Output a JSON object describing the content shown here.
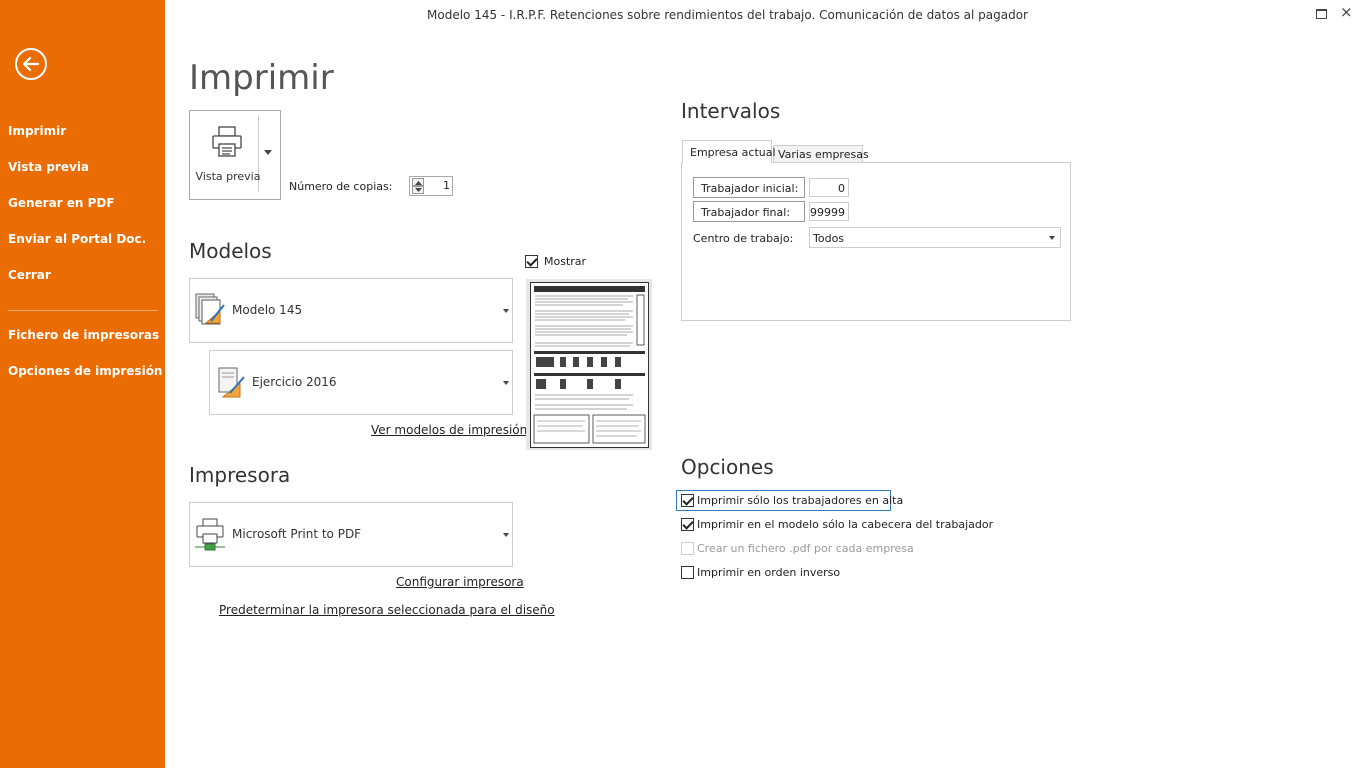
{
  "window": {
    "title": "Modelo 145 - I.R.P.F. Retenciones sobre rendimientos del trabajo. Comunicación de datos al pagador",
    "close_glyph": "×"
  },
  "sidebar": {
    "items": [
      {
        "label": "Imprimir"
      },
      {
        "label": "Vista previa"
      },
      {
        "label": "Generar en PDF"
      },
      {
        "label": "Enviar al Portal Doc."
      },
      {
        "label": "Cerrar"
      },
      {
        "label": "Fichero de impresoras"
      },
      {
        "label": "Opciones de impresión"
      }
    ],
    "color": "#EC6C04"
  },
  "main": {
    "title": "Imprimir",
    "print_button": {
      "label": "Vista previa",
      "icon": "printer-icon"
    },
    "copies": {
      "label": "Número de copias:",
      "value": "1"
    }
  },
  "models": {
    "heading": "Modelos",
    "model_select": {
      "value": "Modelo 145",
      "icon": "model-document-icon"
    },
    "exercise_select": {
      "value": "Ejercicio 2016",
      "icon": "exercise-document-icon"
    },
    "view_models_link": "Ver modelos de impresión",
    "show_label": "Mostrar",
    "show_checked": true
  },
  "printer": {
    "heading": "Impresora",
    "select": {
      "value": "Microsoft Print to PDF",
      "icon": "printer-pdf-icon"
    },
    "configure_link": "Configurar impresora",
    "default_link": "Predeterminar la impresora seleccionada para el diseño"
  },
  "intervals": {
    "heading": "Intervalos",
    "tabs": [
      {
        "label": "Empresa actual",
        "active": true
      },
      {
        "label": "Varias empresas",
        "active": false
      }
    ],
    "trabajador_inicial": {
      "label": "Trabajador inicial:",
      "value": "0"
    },
    "trabajador_final": {
      "label": "Trabajador final:",
      "value": "99999"
    },
    "centro": {
      "label": "Centro de trabajo:",
      "value": "Todos"
    }
  },
  "options": {
    "heading": "Opciones",
    "items": [
      {
        "label": "Imprimir sólo los trabajadores en alta",
        "checked": true,
        "disabled": false
      },
      {
        "label": "Imprimir en el modelo sólo la cabecera del trabajador",
        "checked": true,
        "disabled": false
      },
      {
        "label": "Crear un fichero .pdf por cada empresa",
        "checked": false,
        "disabled": true
      },
      {
        "label": "Imprimir en orden inverso",
        "checked": false,
        "disabled": false
      }
    ]
  },
  "colors": {
    "accent": "#EC6C04",
    "focus": "#2C7BC0"
  }
}
